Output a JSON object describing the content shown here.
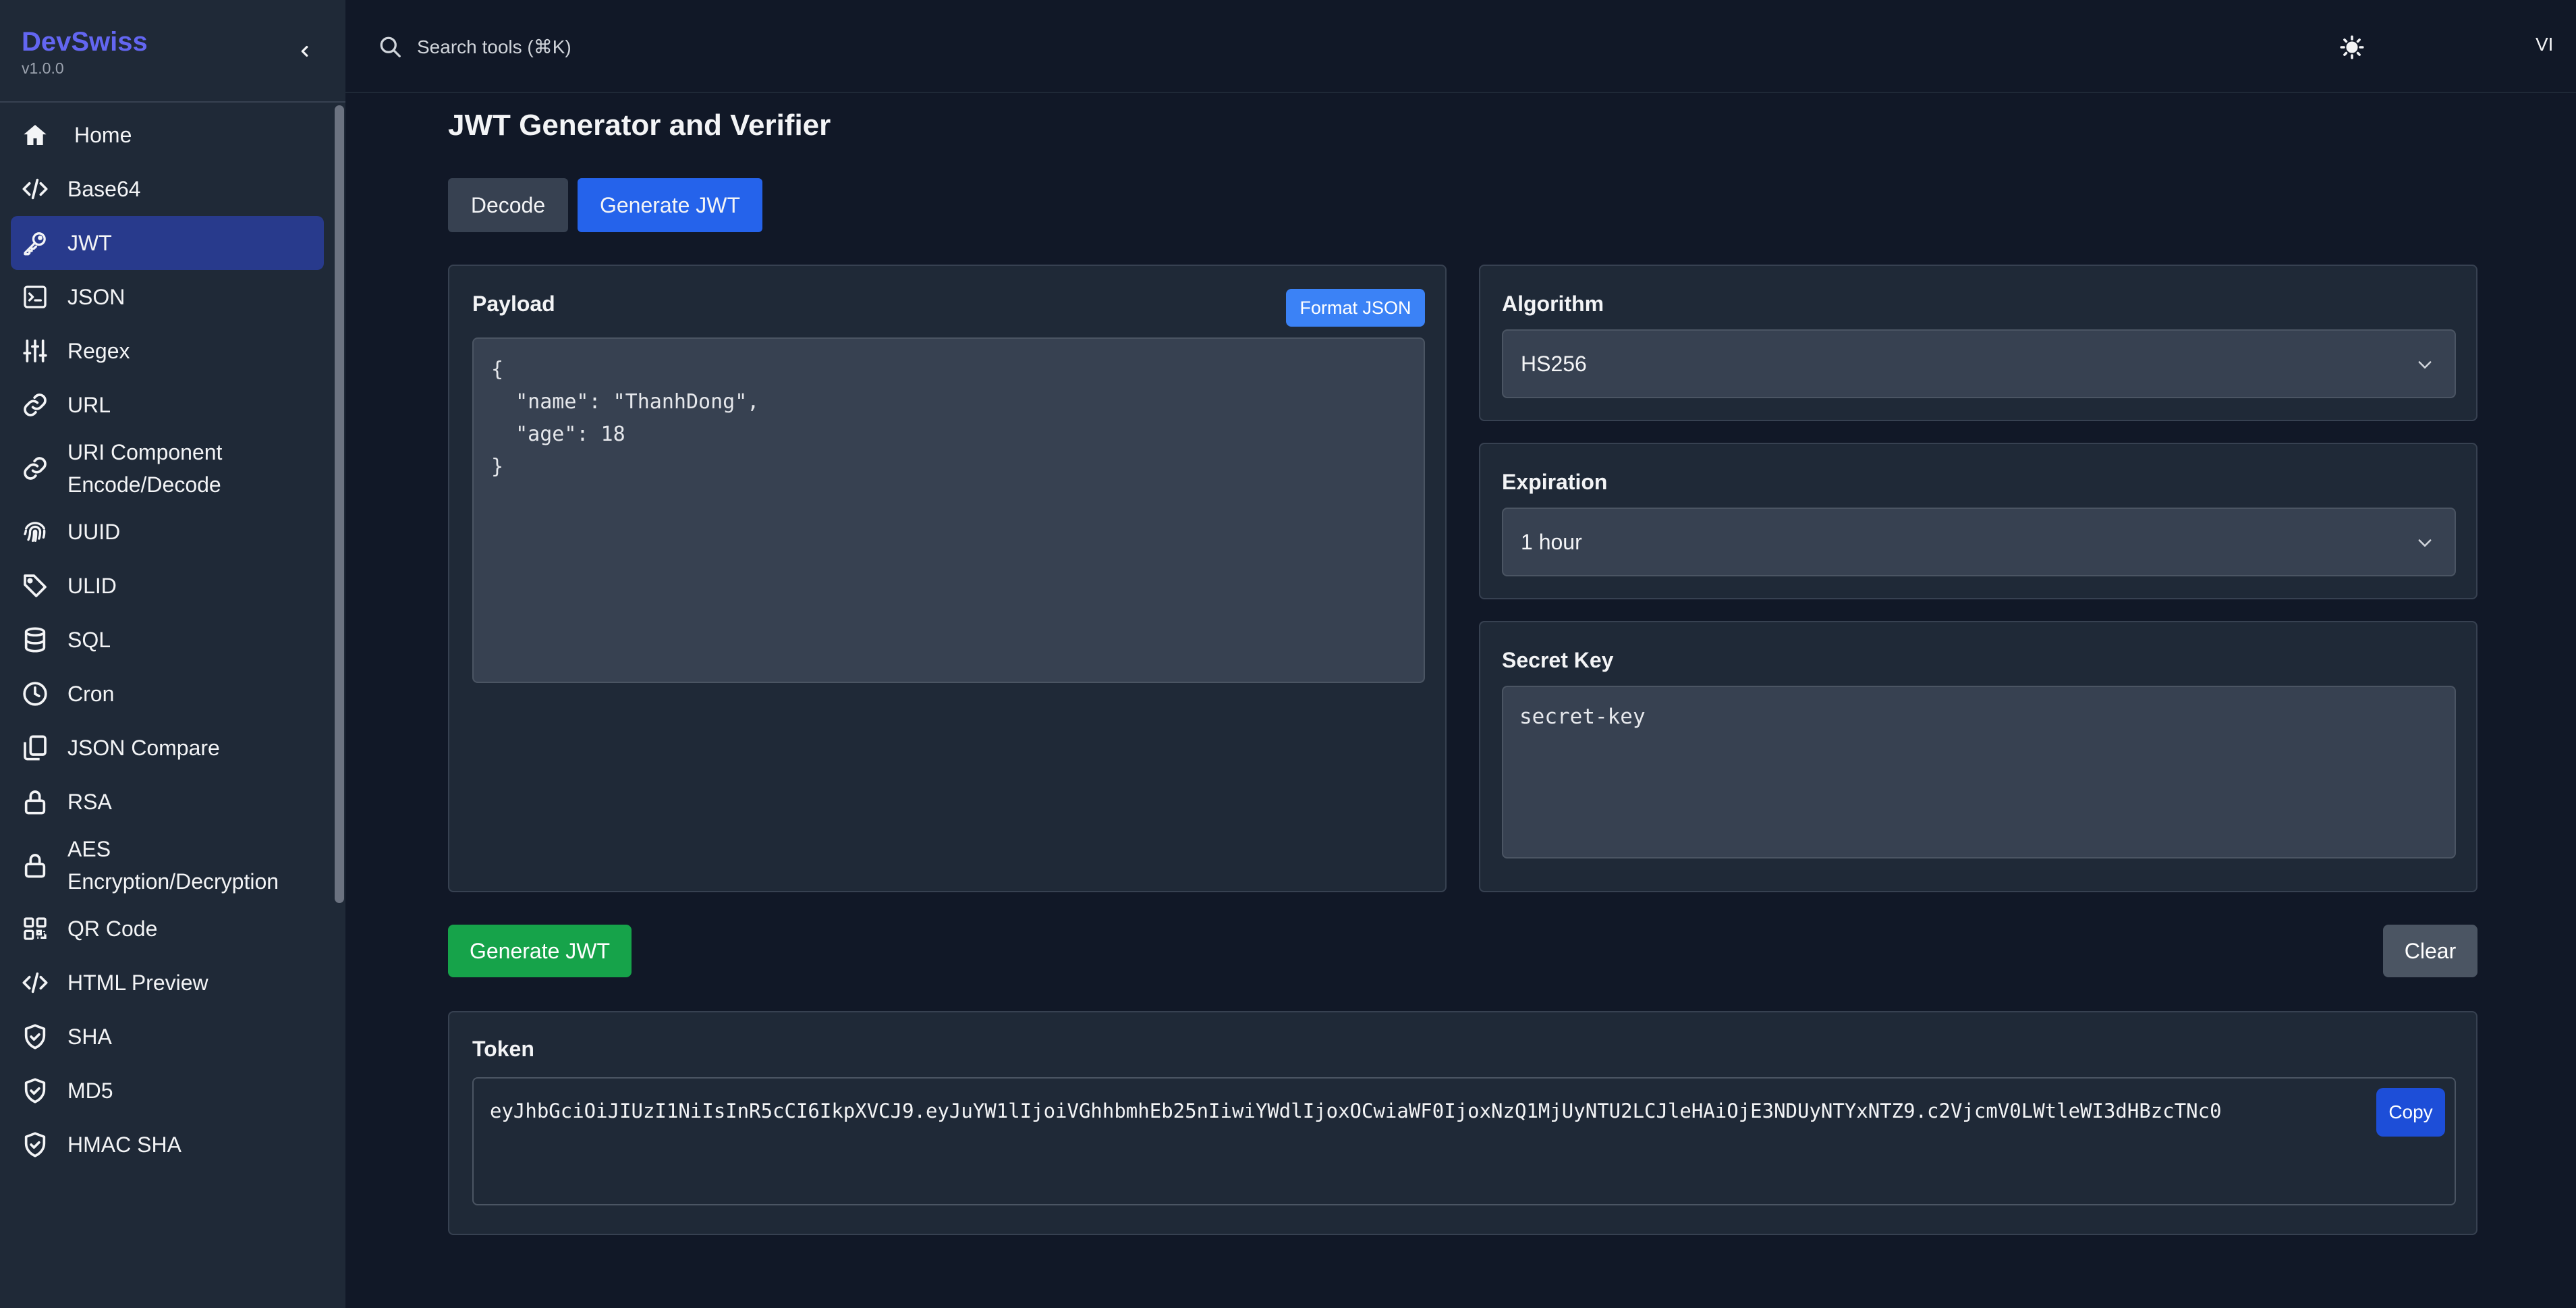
{
  "app": {
    "name": "DevSwiss",
    "version": "v1.0.0"
  },
  "sidebar": {
    "items": [
      {
        "label": "Home",
        "icon": "home-icon"
      },
      {
        "label": "Base64",
        "icon": "code-icon"
      },
      {
        "label": "JWT",
        "icon": "key-icon",
        "active": true
      },
      {
        "label": "JSON",
        "icon": "terminal-icon"
      },
      {
        "label": "Regex",
        "icon": "sliders-icon"
      },
      {
        "label": "URL",
        "icon": "link-icon"
      },
      {
        "label": "URI Component Encode/Decode",
        "icon": "link-icon"
      },
      {
        "label": "UUID",
        "icon": "fingerprint-icon"
      },
      {
        "label": "ULID",
        "icon": "tag-icon"
      },
      {
        "label": "SQL",
        "icon": "database-icon"
      },
      {
        "label": "Cron",
        "icon": "clock-icon"
      },
      {
        "label": "JSON Compare",
        "icon": "copy-icon"
      },
      {
        "label": "RSA",
        "icon": "lock-icon"
      },
      {
        "label": "AES Encryption/Decryption",
        "icon": "lock-icon"
      },
      {
        "label": "QR Code",
        "icon": "qr-code-icon"
      },
      {
        "label": "HTML Preview",
        "icon": "code-icon"
      },
      {
        "label": "SHA",
        "icon": "shield-check-icon"
      },
      {
        "label": "MD5",
        "icon": "shield-check-icon"
      },
      {
        "label": "HMAC SHA",
        "icon": "shield-check-icon"
      }
    ]
  },
  "topbar": {
    "search_placeholder": "Search tools (⌘K)",
    "language": "VI"
  },
  "main": {
    "title": "JWT Generator and Verifier",
    "tabs": [
      {
        "label": "Decode",
        "active": false
      },
      {
        "label": "Generate JWT",
        "active": true
      }
    ],
    "payload": {
      "label": "Payload",
      "format_button": "Format JSON",
      "value": "{\n  \"name\": \"ThanhDong\",\n  \"age\": 18\n}"
    },
    "algorithm": {
      "label": "Algorithm",
      "selected": "HS256"
    },
    "expiration": {
      "label": "Expiration",
      "selected": "1 hour"
    },
    "secret": {
      "label": "Secret Key",
      "value": "secret-key"
    },
    "generate_button": "Generate JWT",
    "clear_button": "Clear",
    "token": {
      "label": "Token",
      "value": "eyJhbGciOiJIUzI1NiIsInR5cCI6IkpXVCJ9.eyJuYW1lIjoiVGhhbmhEb25nIiwiYWdlIjoxOCwiaWF0IjoxNzQ1MjUyNTU2LCJleHAiOjE3NDUyNTYxNTZ9.c2VjcmV0LWtleWI3dHBzcTNc0",
      "copy_button": "Copy"
    }
  },
  "colors": {
    "brand": "#6366f1",
    "primary": "#2563eb",
    "success": "#16a34a",
    "active_nav": "#283a8c"
  }
}
